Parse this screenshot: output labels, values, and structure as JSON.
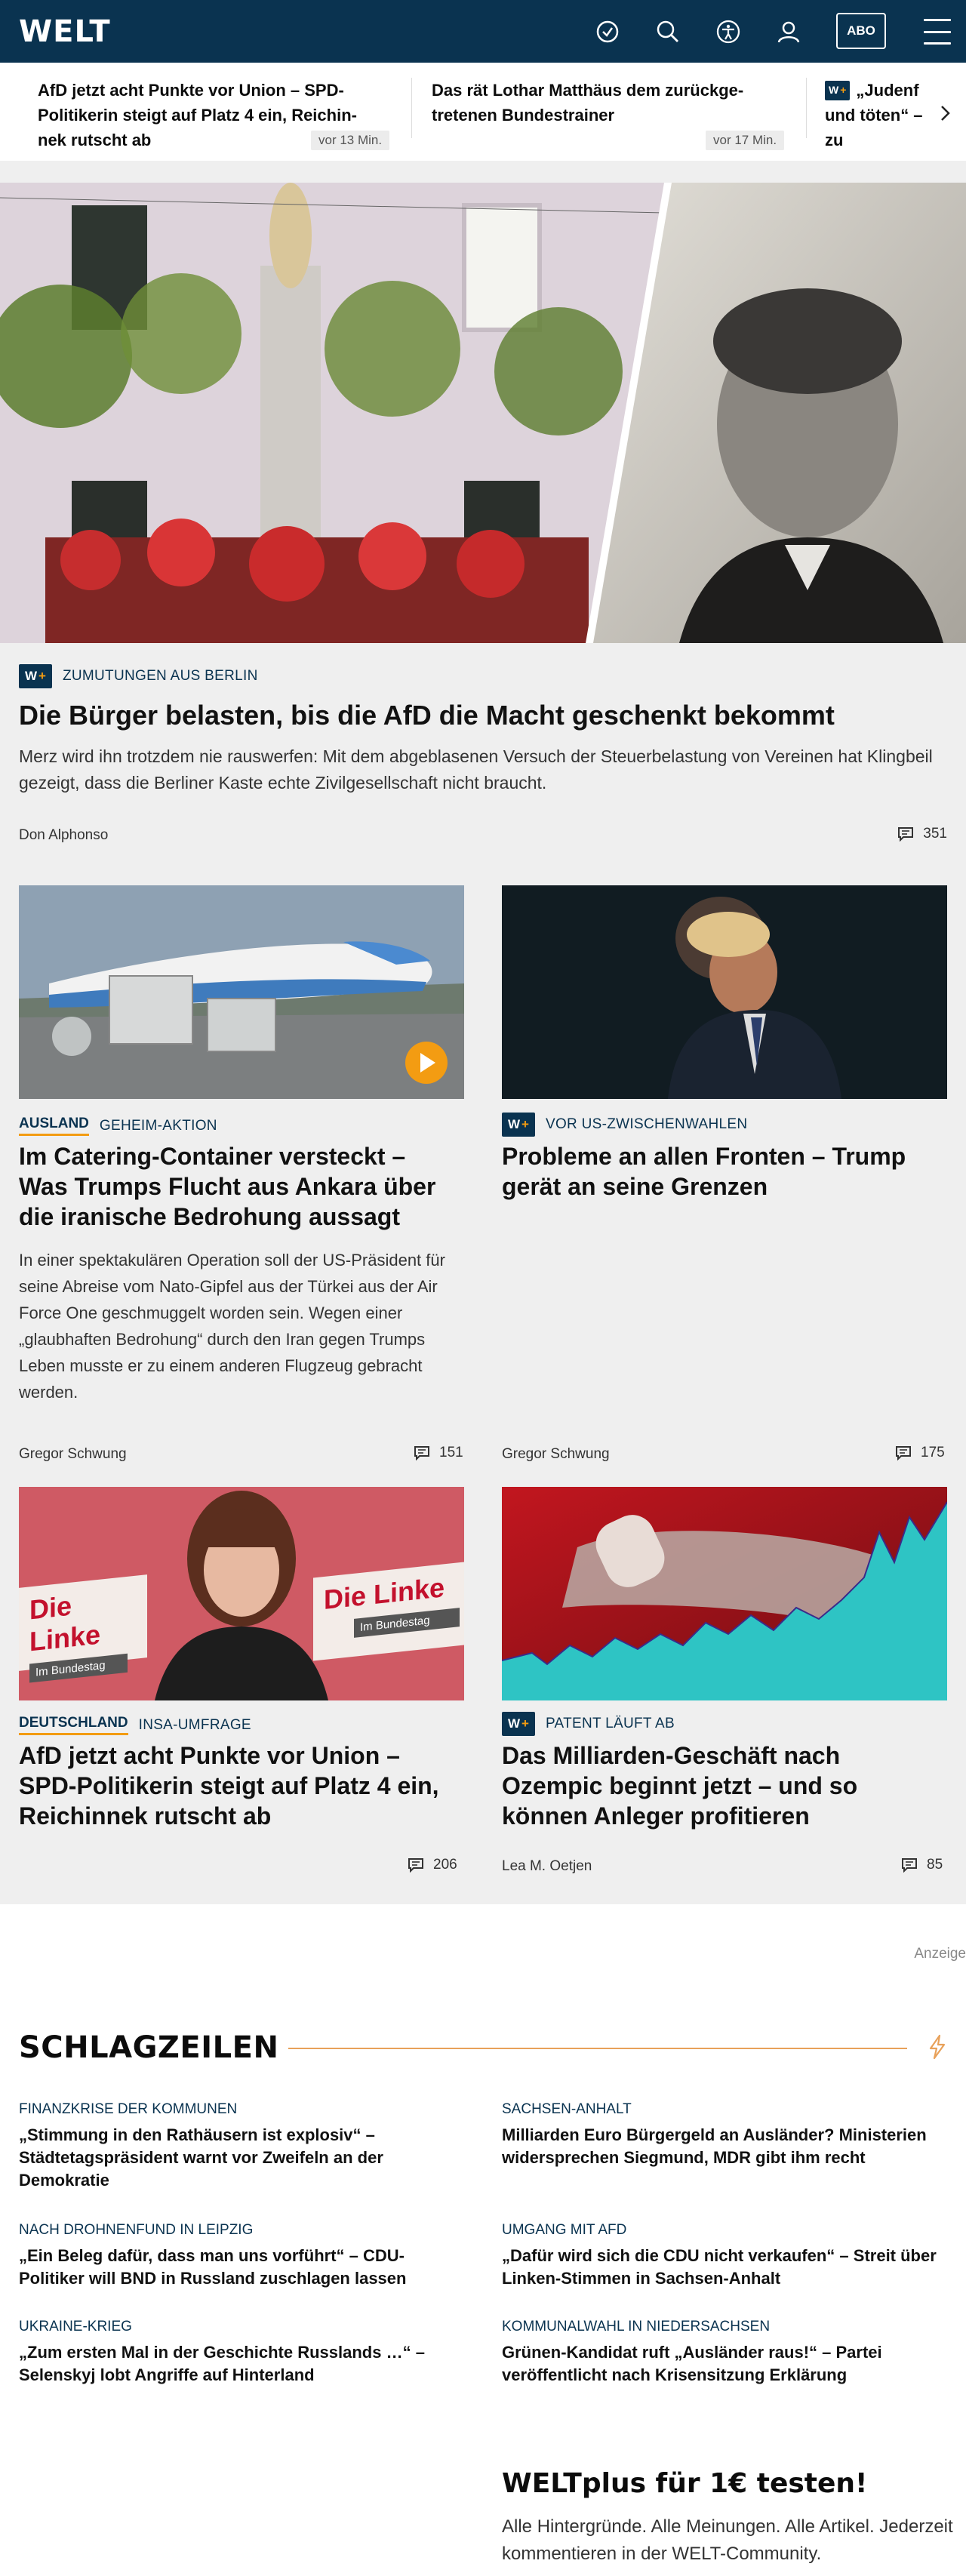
{
  "header": {
    "logo": "WELT",
    "abo_label": "ABO",
    "icons": [
      "clock-icon",
      "search-icon",
      "accessibility-icon",
      "user-icon",
      "menu-icon"
    ]
  },
  "ticker": [
    {
      "title": "AfD jetzt acht Punkte vor Union – SPD-Politikerin steigt auf Platz 4 ein, Reichin-nek rutscht ab",
      "line1": "AfD jetzt acht Punkte vor Union – SPD-",
      "line2": "Politikerin steigt auf Platz 4 ein, Reichin-",
      "line3": "nek rutscht ab",
      "time": "vor 13 Min."
    },
    {
      "line1": "Das rät Lothar Matthäus dem zurückge-",
      "line2": "tretenen Bundestrainer",
      "time": "vor 17 Min."
    },
    {
      "line1": "„Judenf",
      "line2": "und töten“ –",
      "line3": "zu"
    }
  ],
  "hero": {
    "kicker": "ZUMUTUNGEN AUS BERLIN",
    "badge": "W+",
    "headline": "Die Bürger belasten, bis die AfD die Macht geschenkt bekommt",
    "teaser": "Merz wird ihn trotzdem nie rauswerfen: Mit dem abgeblasenen Versuch der Steuerbelastung von Vereinen hat Klingbeil gezeigt, dass die Berliner Kaste echte Zivilgesellschaft nicht braucht.",
    "author": "Don Alphonso",
    "comments": "351"
  },
  "cards": [
    {
      "category": "AUSLAND",
      "kicker": "GEHEIM-AKTION",
      "headline": "Im Catering-Container versteckt – Was Trumps Flucht aus Ankara über die iranische Bedrohung aussagt",
      "teaser": "In einer spektakulären Operation soll der US-Präsident für seine Abreise vom Nato-Gipfel aus der Türkei aus der Air Force One geschmuggelt worden sein. Wegen einer „glaubhaften Bedrohung“ durch den Iran gegen Trumps Leben musste er zu einem anderen Flugzeug gebracht werden.",
      "author": "Gregor Schwung",
      "comments": "151"
    },
    {
      "badge": "W+",
      "kicker": "VOR US-ZWISCHENWAHLEN",
      "headline": "Probleme an allen Fronten – Trump gerät an seine Grenzen",
      "author": "Gregor Schwung",
      "comments": "175"
    },
    {
      "category": "DEUTSCHLAND",
      "kicker": "INSA-UMFRAGE",
      "headline": "AfD jetzt acht Punkte vor Union – SPD-Politikerin steigt auf Platz 4 ein, Reichinnek rutscht ab",
      "comments": "206",
      "img_text1": "Die Linke",
      "img_text2": "Im Bundestag",
      "img_text3": "Die Linke",
      "img_text4": "Im Bundestag"
    },
    {
      "badge": "W+",
      "kicker": "PATENT LÄUFT AB",
      "headline": "Das Milliarden-Geschäft nach Ozempic beginnt jetzt – und so können Anleger profitieren",
      "author": "Lea M. Oetjen",
      "comments": "85"
    }
  ],
  "ad_label": "Anzeige",
  "schlagzeilen": {
    "title": "SCHLAGZEILEN",
    "items": [
      {
        "kicker": "FINANZKRISE DER KOMMUNEN",
        "headline": "„Stimmung in den Rathäusern ist explosiv“ – Städtetagspräsident warnt vor Zweifeln an der Demokratie"
      },
      {
        "kicker": "SACHSEN-ANHALT",
        "headline": "Milliarden Euro Bürgergeld an Ausländer? Ministerien widersprechen Siegmund, MDR gibt ihm recht"
      },
      {
        "kicker": "NACH DROHNENFUND IN LEIPZIG",
        "headline": "„Ein Beleg dafür, dass man uns vorführt“ – CDU-Politiker will BND in Russland zuschlagen lassen"
      },
      {
        "kicker": "UMGANG MIT AFD",
        "headline": "„Dafür wird sich die CDU nicht verkaufen“ – Streit über Linken-Stimmen in Sachsen-Anhalt"
      },
      {
        "kicker": "UKRAINE-KRIEG",
        "headline": "„Zum ersten Mal in der Geschichte Russlands …“ – Selenskyj lobt Angriffe auf Hinterland"
      },
      {
        "kicker": "KOMMUNALWAHL IN NIEDERSACHSEN",
        "headline": "Grünen-Kandidat ruft „Ausländer raus!“ – Partei veröffentlicht nach Krisensitzung Erklärung"
      }
    ]
  },
  "promo": {
    "title": "WELTplus für 1€ testen!",
    "text": "Alle Hintergründe. Alle Meinungen. Alle Artikel. Jederzeit kommentieren in der WELT-Community."
  },
  "colors": {
    "brand_navy": "#0a3350",
    "accent_orange": "#f39c12",
    "background_gray": "#efefef"
  }
}
